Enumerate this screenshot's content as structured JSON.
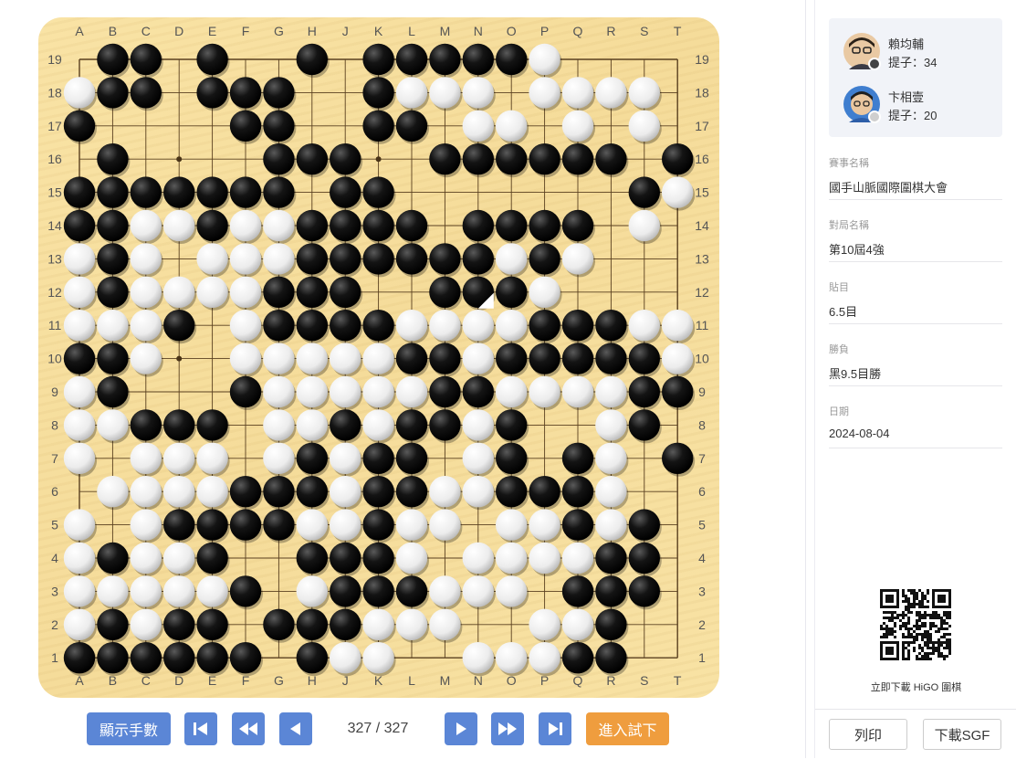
{
  "board": {
    "size": 19,
    "columns": [
      "A",
      "B",
      "C",
      "D",
      "E",
      "F",
      "G",
      "H",
      "J",
      "K",
      "L",
      "M",
      "N",
      "O",
      "P",
      "Q",
      "R",
      "S",
      "T"
    ],
    "rows": [
      "1",
      "2",
      "3",
      "4",
      "5",
      "6",
      "7",
      "8",
      "9",
      "10",
      "11",
      "12",
      "13",
      "14",
      "15",
      "16",
      "17",
      "18",
      "19"
    ],
    "star_points": [
      "D4",
      "K4",
      "Q4",
      "D10",
      "K10",
      "Q10",
      "D16",
      "K16",
      "Q16"
    ],
    "last_move": "N12",
    "position": [
      ".XX.X..X.XXXXXO....",
      "OXX.XXX..XOOO.OOOO.",
      "X....XX..XX.OO.O.O.",
      ".X....XXX..XXXXXX.X",
      "XXXXXXX.XX.......XO",
      "XXOOXOOXXXX.XXXX.O.",
      "OXO.OOOXXXXXXOXO...",
      "OXOOOOXXX..XXXO....",
      "OOOX.OXXXXOOOOXXXOO",
      "XXO..OOOOOXXOXXXXXO",
      "OX...XOOOOOXXOOOOXX",
      "OOXXX.OOXOXXOX..OX.",
      "O.OOO.OXOXX.OX.XO.X",
      ".OOOOXXXOXXOOXXXO..",
      "O.OXXXXOOXOO.OOXOX.",
      "OXOOX..XXXO.OOOOXX.",
      "OOOOOX.OXXXOOO.XXX.",
      "OXOXX.XXXOOO..OOX..",
      "XXXXXX.XOO..OOOXX.."
    ]
  },
  "controls": {
    "show_numbers": "顯示手數",
    "first_icon": "first-move-icon",
    "back10_icon": "fast-backward-icon",
    "prev_icon": "prev-move-icon",
    "move_counter": "327 / 327",
    "next_icon": "next-move-icon",
    "fwd10_icon": "fast-forward-icon",
    "last_icon": "last-move-icon",
    "try_mode": "進入試下"
  },
  "players": [
    {
      "name": "賴均輔",
      "captures": "提子：34",
      "color": "black"
    },
    {
      "name": "卞相壹",
      "captures": "提子：20",
      "color": "white"
    }
  ],
  "info": [
    {
      "label": "賽事名稱",
      "value": "國手山脈國際圍棋大會"
    },
    {
      "label": "對局名稱",
      "value": "第10屆4強"
    },
    {
      "label": "貼目",
      "value": "6.5目"
    },
    {
      "label": "勝負",
      "value": "黑9.5目勝"
    },
    {
      "label": "日期",
      "value": "2024-08-04"
    }
  ],
  "qr_caption": "立即下載 HiGO 圍棋",
  "actions": {
    "print": "列印",
    "download": "下載SGF"
  },
  "colors": {
    "accent_blue": "#5b86d6",
    "accent_orange": "#ef9d3e",
    "board": "#f6dd9c"
  }
}
